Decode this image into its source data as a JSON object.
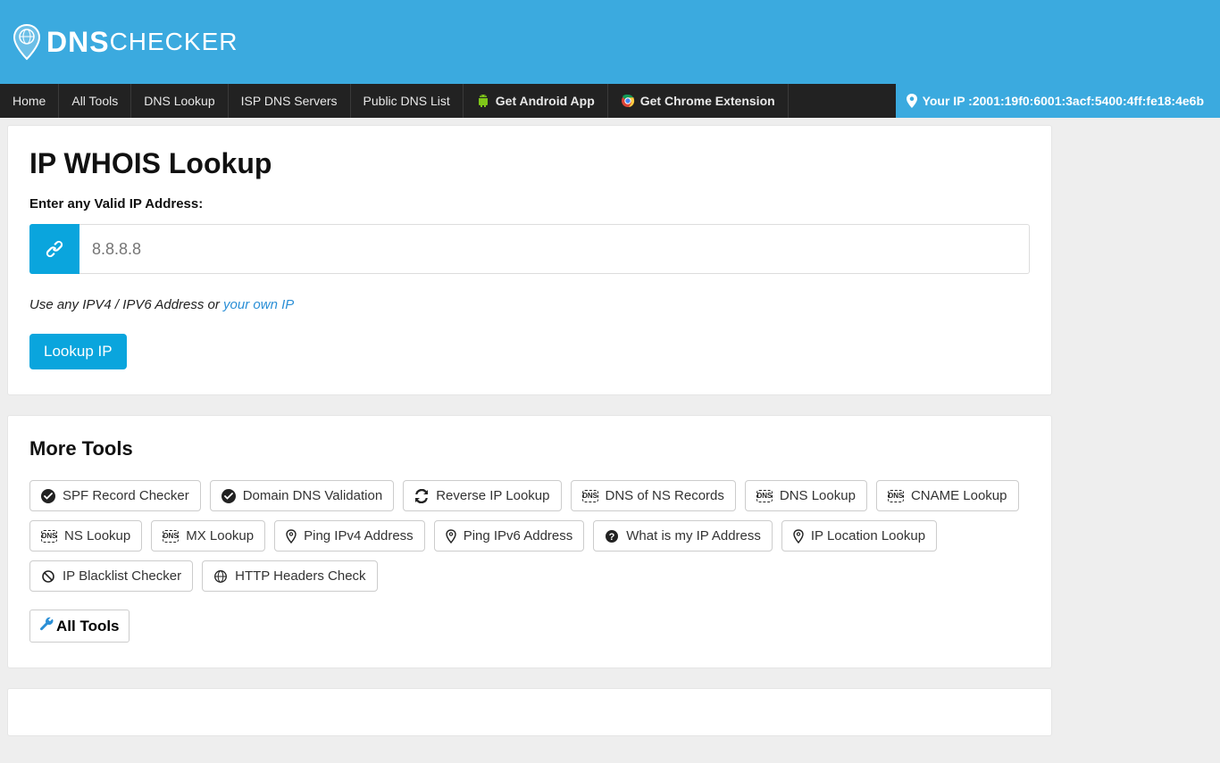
{
  "brand": {
    "dns": "DNS",
    "checker": "CHECKER"
  },
  "nav": {
    "items": [
      {
        "label": "Home"
      },
      {
        "label": "All Tools"
      },
      {
        "label": "DNS Lookup"
      },
      {
        "label": "ISP DNS Servers"
      },
      {
        "label": "Public DNS List"
      },
      {
        "label": "Get Android App",
        "icon": "android"
      },
      {
        "label": "Get Chrome Extension",
        "icon": "chrome"
      }
    ],
    "your_ip_prefix": "Your IP : ",
    "your_ip_value": "2001:19f0:6001:3acf:5400:4ff:fe18:4e6b"
  },
  "page": {
    "title": "IP WHOIS Lookup",
    "field_label": "Enter any Valid IP Address:",
    "placeholder": "8.8.8.8",
    "input_value": "",
    "hint_prefix": "Use any IPV4 / IPV6 Address or ",
    "hint_link": "your own IP",
    "submit_label": "Lookup IP"
  },
  "tools": {
    "title": "More Tools",
    "items": [
      {
        "label": "SPF Record Checker",
        "icon": "check"
      },
      {
        "label": "Domain DNS Validation",
        "icon": "check"
      },
      {
        "label": "Reverse IP Lookup",
        "icon": "refresh"
      },
      {
        "label": "DNS of NS Records",
        "icon": "dns"
      },
      {
        "label": "DNS Lookup",
        "icon": "dns"
      },
      {
        "label": "CNAME Lookup",
        "icon": "dns"
      },
      {
        "label": "NS Lookup",
        "icon": "dns"
      },
      {
        "label": "MX Lookup",
        "icon": "dns"
      },
      {
        "label": "Ping IPv4 Address",
        "icon": "pin"
      },
      {
        "label": "Ping IPv6 Address",
        "icon": "pin"
      },
      {
        "label": "What is my IP Address",
        "icon": "question"
      },
      {
        "label": "IP Location Lookup",
        "icon": "pin"
      },
      {
        "label": "IP Blacklist Checker",
        "icon": "block"
      },
      {
        "label": "HTTP Headers Check",
        "icon": "globe"
      }
    ],
    "all_tools_label": "All Tools"
  }
}
